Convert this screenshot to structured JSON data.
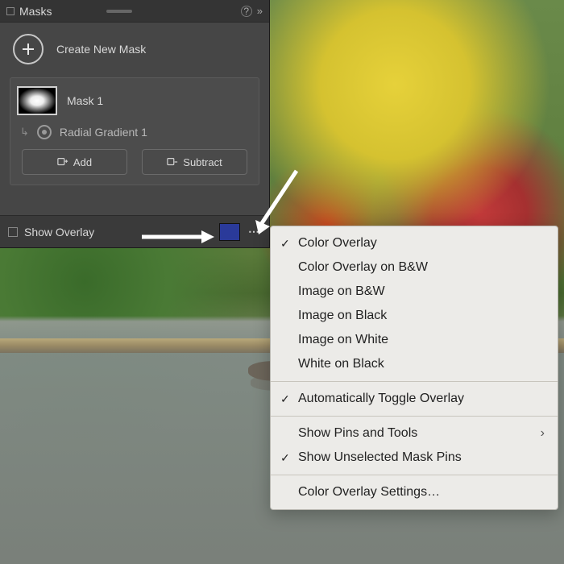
{
  "panel": {
    "title": "Masks",
    "create_label": "Create New Mask",
    "mask": {
      "name": "Mask 1",
      "component": "Radial Gradient 1"
    },
    "buttons": {
      "add": "Add",
      "subtract": "Subtract"
    },
    "footer": {
      "show_overlay": "Show Overlay",
      "overlay_color": "#2a3a9a"
    }
  },
  "menu": {
    "items": [
      {
        "label": "Color Overlay",
        "checked": true
      },
      {
        "label": "Color Overlay on B&W",
        "checked": false
      },
      {
        "label": "Image on B&W",
        "checked": false
      },
      {
        "label": "Image on Black",
        "checked": false
      },
      {
        "label": "Image on White",
        "checked": false
      },
      {
        "label": "White on Black",
        "checked": false
      }
    ],
    "auto_toggle": "Automatically Toggle Overlay",
    "show_pins": "Show Pins and Tools",
    "show_unselected": "Show Unselected Mask Pins",
    "settings": "Color Overlay Settings…"
  }
}
